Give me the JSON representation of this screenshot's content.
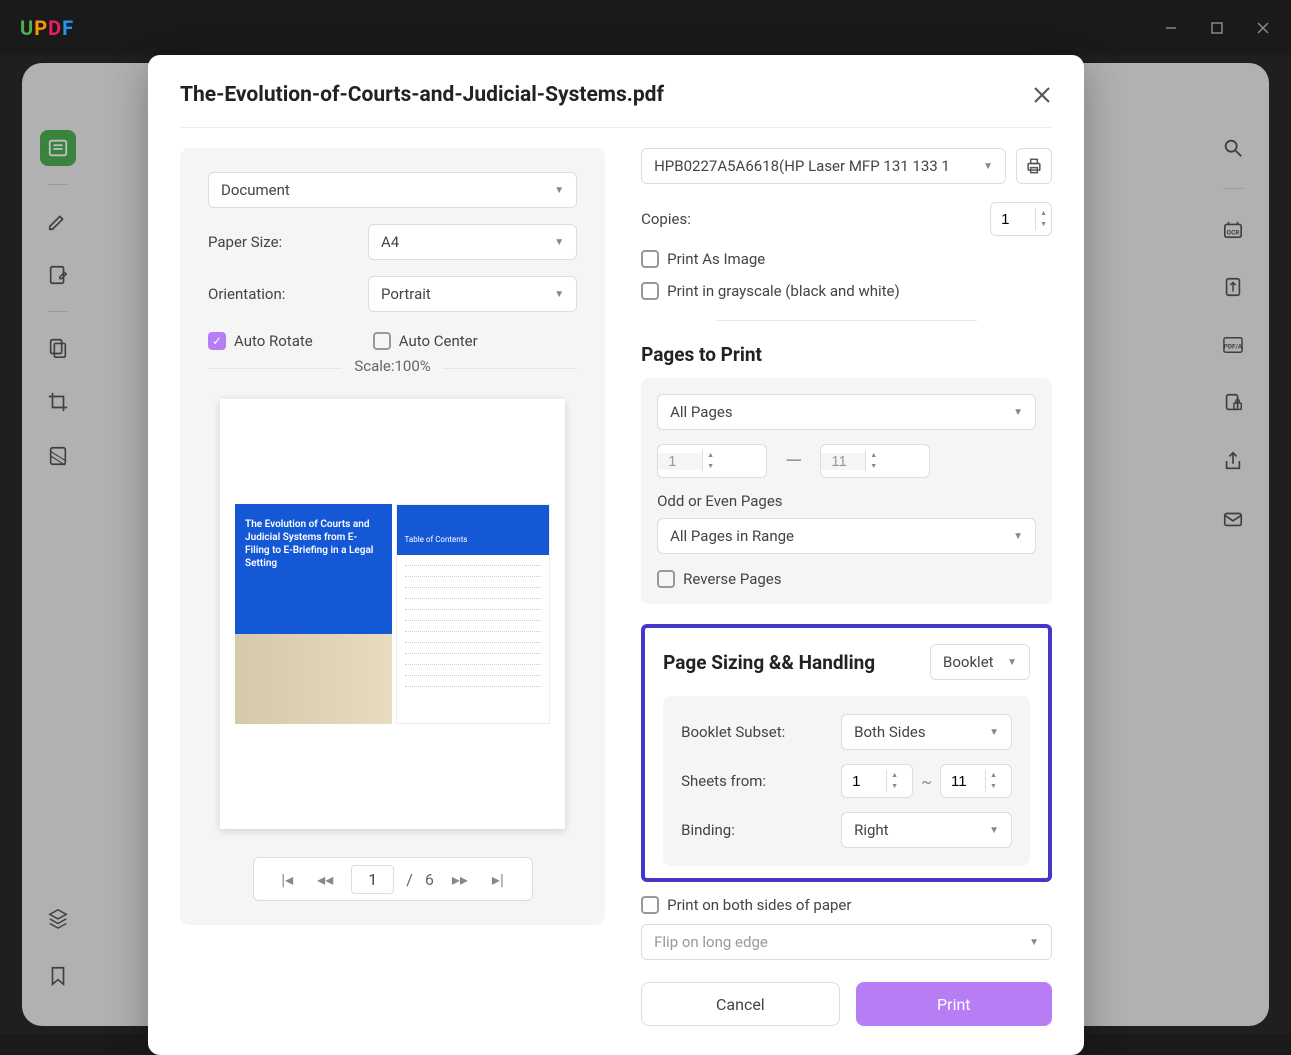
{
  "app": {
    "name": "UPDF"
  },
  "modal": {
    "title": "The-Evolution-of-Courts-and-Judicial-Systems.pdf",
    "mode_select": "Document",
    "paper_size_label": "Paper Size:",
    "paper_size": "A4",
    "orientation_label": "Orientation:",
    "orientation": "Portrait",
    "auto_rotate": "Auto Rotate",
    "auto_center": "Auto Center",
    "scale_label": "Scale:100%",
    "preview_left_title": "The Evolution of Courts and Judicial Systems from E-Filing to E-Briefing in a Legal Setting",
    "preview_right_head": "Table of Contents",
    "pager": {
      "current": "1",
      "sep": "/",
      "total": "6"
    }
  },
  "printer": {
    "selected": "HPB0227A5A6618(HP Laser MFP 131 133 1",
    "copies_label": "Copies:",
    "copies": "1",
    "print_as_image": "Print As Image",
    "print_grayscale": "Print in grayscale (black and white)"
  },
  "pages": {
    "title": "Pages to Print",
    "range_select": "All Pages",
    "from": "1",
    "to": "11",
    "odd_even_label": "Odd or Even Pages",
    "odd_even": "All Pages in Range",
    "reverse": "Reverse Pages"
  },
  "sizing": {
    "title": "Page Sizing && Handling",
    "mode": "Booklet",
    "booklet_subset_label": "Booklet Subset:",
    "booklet_subset": "Both Sides",
    "sheets_label": "Sheets from:",
    "sheets_from": "1",
    "sheets_to": "11",
    "binding_label": "Binding:",
    "binding": "Right"
  },
  "duplex": {
    "both_sides": "Print on both sides of paper",
    "flip": "Flip on long edge"
  },
  "buttons": {
    "cancel": "Cancel",
    "print": "Print"
  }
}
